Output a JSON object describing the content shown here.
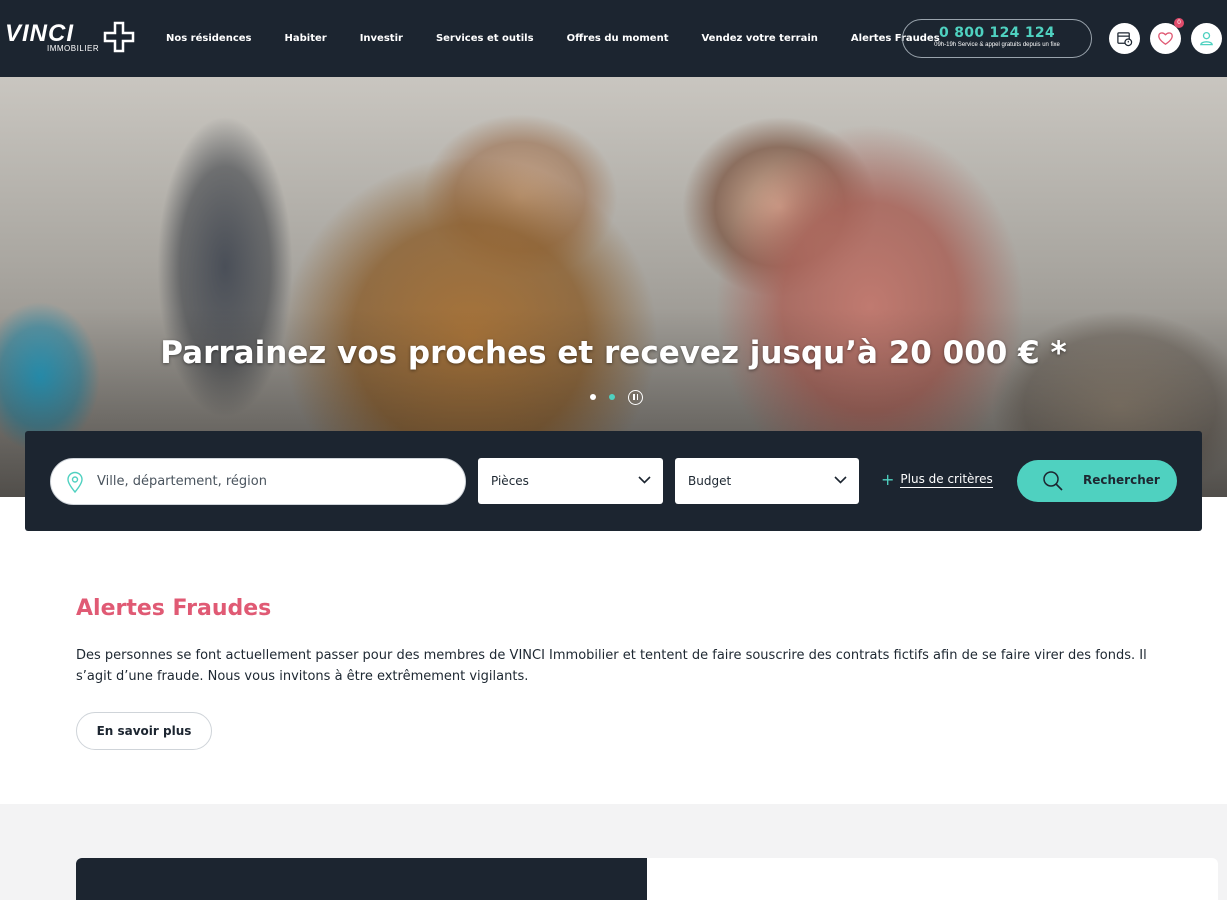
{
  "header": {
    "logo": {
      "name": "VINCI",
      "sub": "IMMOBILIER"
    },
    "nav": [
      "Nos résidences",
      "Habiter",
      "Investir",
      "Services et outils",
      "Offres du moment",
      "Vendez votre terrain",
      "Alertes Fraudes"
    ],
    "phone": {
      "number": "0 800 124 124",
      "sub": "09h-19h Service & appel gratuits depuis un fixe"
    },
    "icons": [
      "appointment-icon",
      "heart-icon",
      "user-icon"
    ],
    "favorites_count": "0"
  },
  "hero": {
    "title": "Parrainez vos proches et recevez jusqu’à 20 000 € *",
    "slides_count": 2,
    "active_slide": 2
  },
  "search": {
    "location_placeholder": "Ville, département, région",
    "rooms_label": "Pièces",
    "budget_label": "Budget",
    "more_criteria": "Plus de critères",
    "search_label": "Rechercher"
  },
  "fraud": {
    "title": "Alertes Fraudes",
    "text": "Des personnes se font actuellement passer pour des membres de VINCI Immobilier et tentent de faire souscrire des contrats fictifs afin de se faire virer des fonds. Il s’agit d’une fraude. Nous vous invitons à être extrêmement vigilants.",
    "cta": "En savoir plus"
  },
  "colors": {
    "navy": "#1c2530",
    "teal": "#4fd1c0",
    "pink": "#e05a74"
  }
}
